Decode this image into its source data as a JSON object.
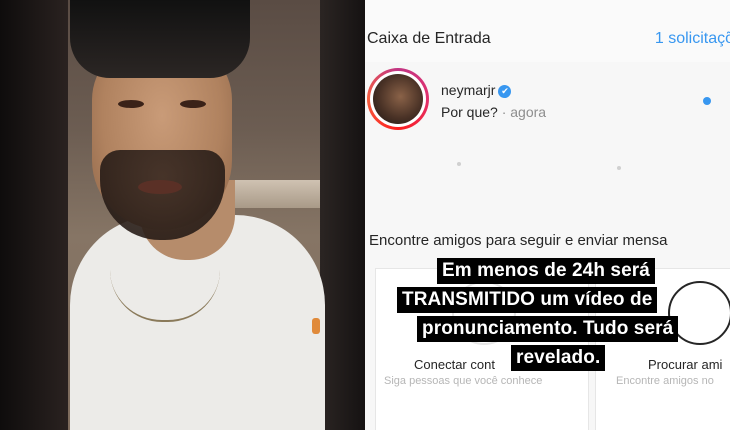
{
  "inbox": {
    "title": "Caixa de Entrada",
    "requests_link": "1 solicitaçõ"
  },
  "thread": {
    "username": "neymarjr",
    "verified_icon": "✔",
    "preview": "Por que?",
    "timestamp": "· agora"
  },
  "suggestions": {
    "title": "Encontre amigos para seguir e enviar mensa",
    "cards": [
      {
        "label": "Conectar cont",
        "sub": "Siga pessoas que você conhece"
      },
      {
        "label": "Procurar ami",
        "sub": "Encontre amigos no"
      }
    ]
  },
  "caption": {
    "line1": "Em menos de 24h será",
    "line2": "TRANSMITIDO um vídeo de",
    "line3": "pronunciamento. Tudo será",
    "line4": "revelado."
  },
  "colors": {
    "accent": "#3897f0",
    "caption_bg": "#000000",
    "caption_text": "#ffffff"
  }
}
